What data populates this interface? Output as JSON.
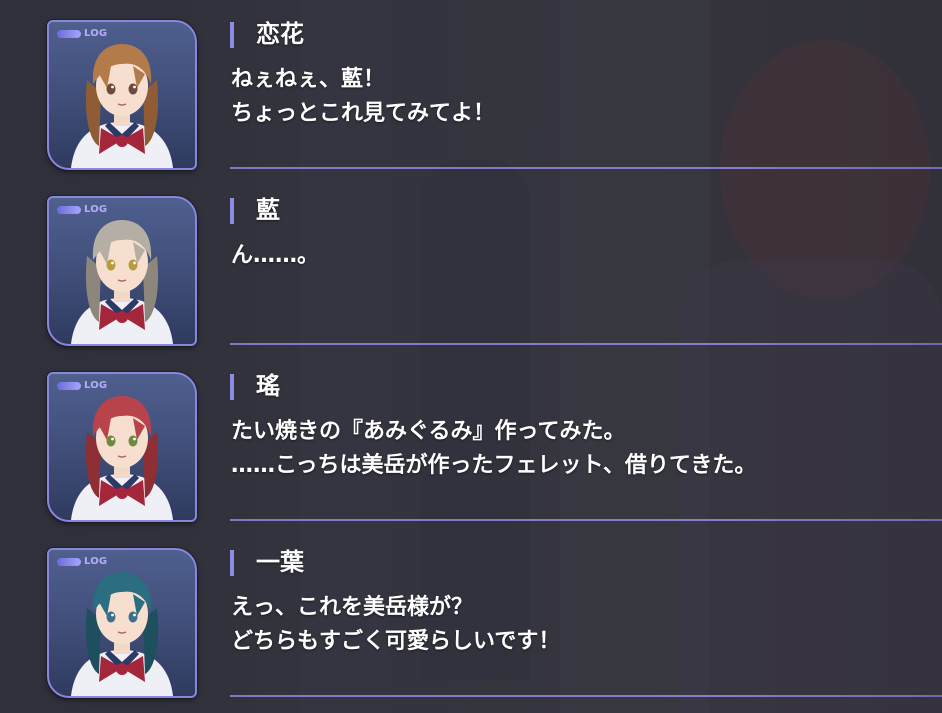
{
  "backlog": {
    "log_badge_label": "LOG",
    "entries": [
      {
        "speaker": "恋花",
        "lines": [
          "ねぇねぇ、藍！",
          "ちょっとこれ見てみてよ！"
        ],
        "portrait": {
          "hair": "#b37a4a",
          "hair_shade": "#8f5c36",
          "eyes": "#6d4a3c"
        }
      },
      {
        "speaker": "藍",
        "lines": [
          "ん……。",
          ""
        ],
        "portrait": {
          "hair": "#b4aea4",
          "hair_shade": "#8c867d",
          "eyes": "#b89b3f"
        }
      },
      {
        "speaker": "瑤",
        "lines": [
          "たい焼きの『あみぐるみ』作ってみた。",
          "……こっちは美岳が作ったフェレット、借りてきた。"
        ],
        "portrait": {
          "hair": "#b8434a",
          "hair_shade": "#8e2e35",
          "eyes": "#6e8a3e"
        }
      },
      {
        "speaker": "一葉",
        "lines": [
          "えっ、これを美岳様が？",
          "どちらもすごく可愛らしいです！"
        ],
        "portrait": {
          "hair": "#2a6e80",
          "hair_shade": "#1d4f5e",
          "eyes": "#3d6f8c"
        }
      }
    ]
  },
  "colors": {
    "accent": "#8e8be4",
    "text": "#ffffff",
    "ribbon": "#a3263a"
  }
}
